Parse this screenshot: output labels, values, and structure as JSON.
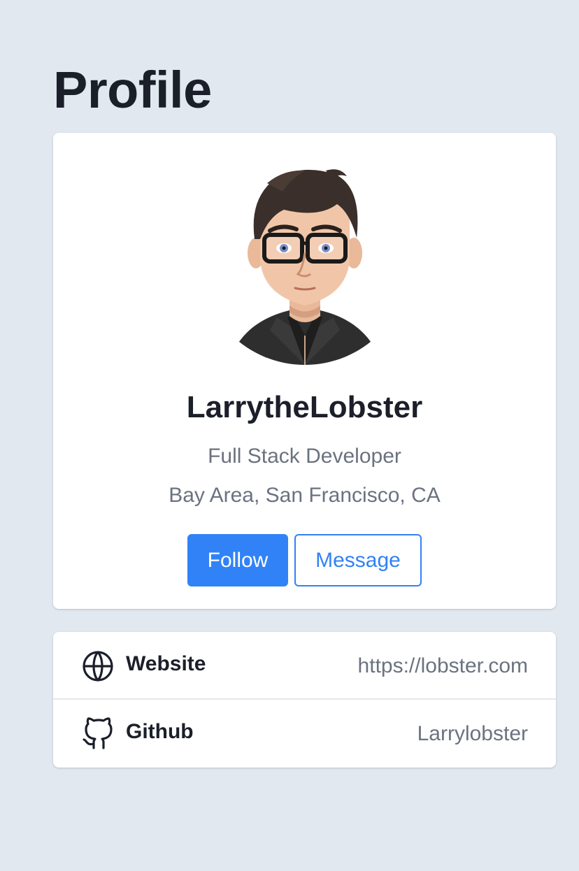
{
  "page": {
    "title": "Profile"
  },
  "profile": {
    "name": "LarrytheLobster",
    "role": "Full Stack Developer",
    "location": "Bay Area, San Francisco, CA",
    "avatar_icon": "cartoon-avatar-man-glasses",
    "actions": {
      "follow_label": "Follow",
      "message_label": "Message"
    }
  },
  "links": [
    {
      "label": "Website",
      "value": "https://lobster.com",
      "icon": "globe-icon"
    },
    {
      "label": "Github",
      "value": "Larrylobster",
      "icon": "github-icon"
    }
  ],
  "colors": {
    "background": "#e2e8f0",
    "card": "#ffffff",
    "accent": "#3182f6",
    "text_primary": "#1b1f2a",
    "text_muted": "#6b7280"
  }
}
